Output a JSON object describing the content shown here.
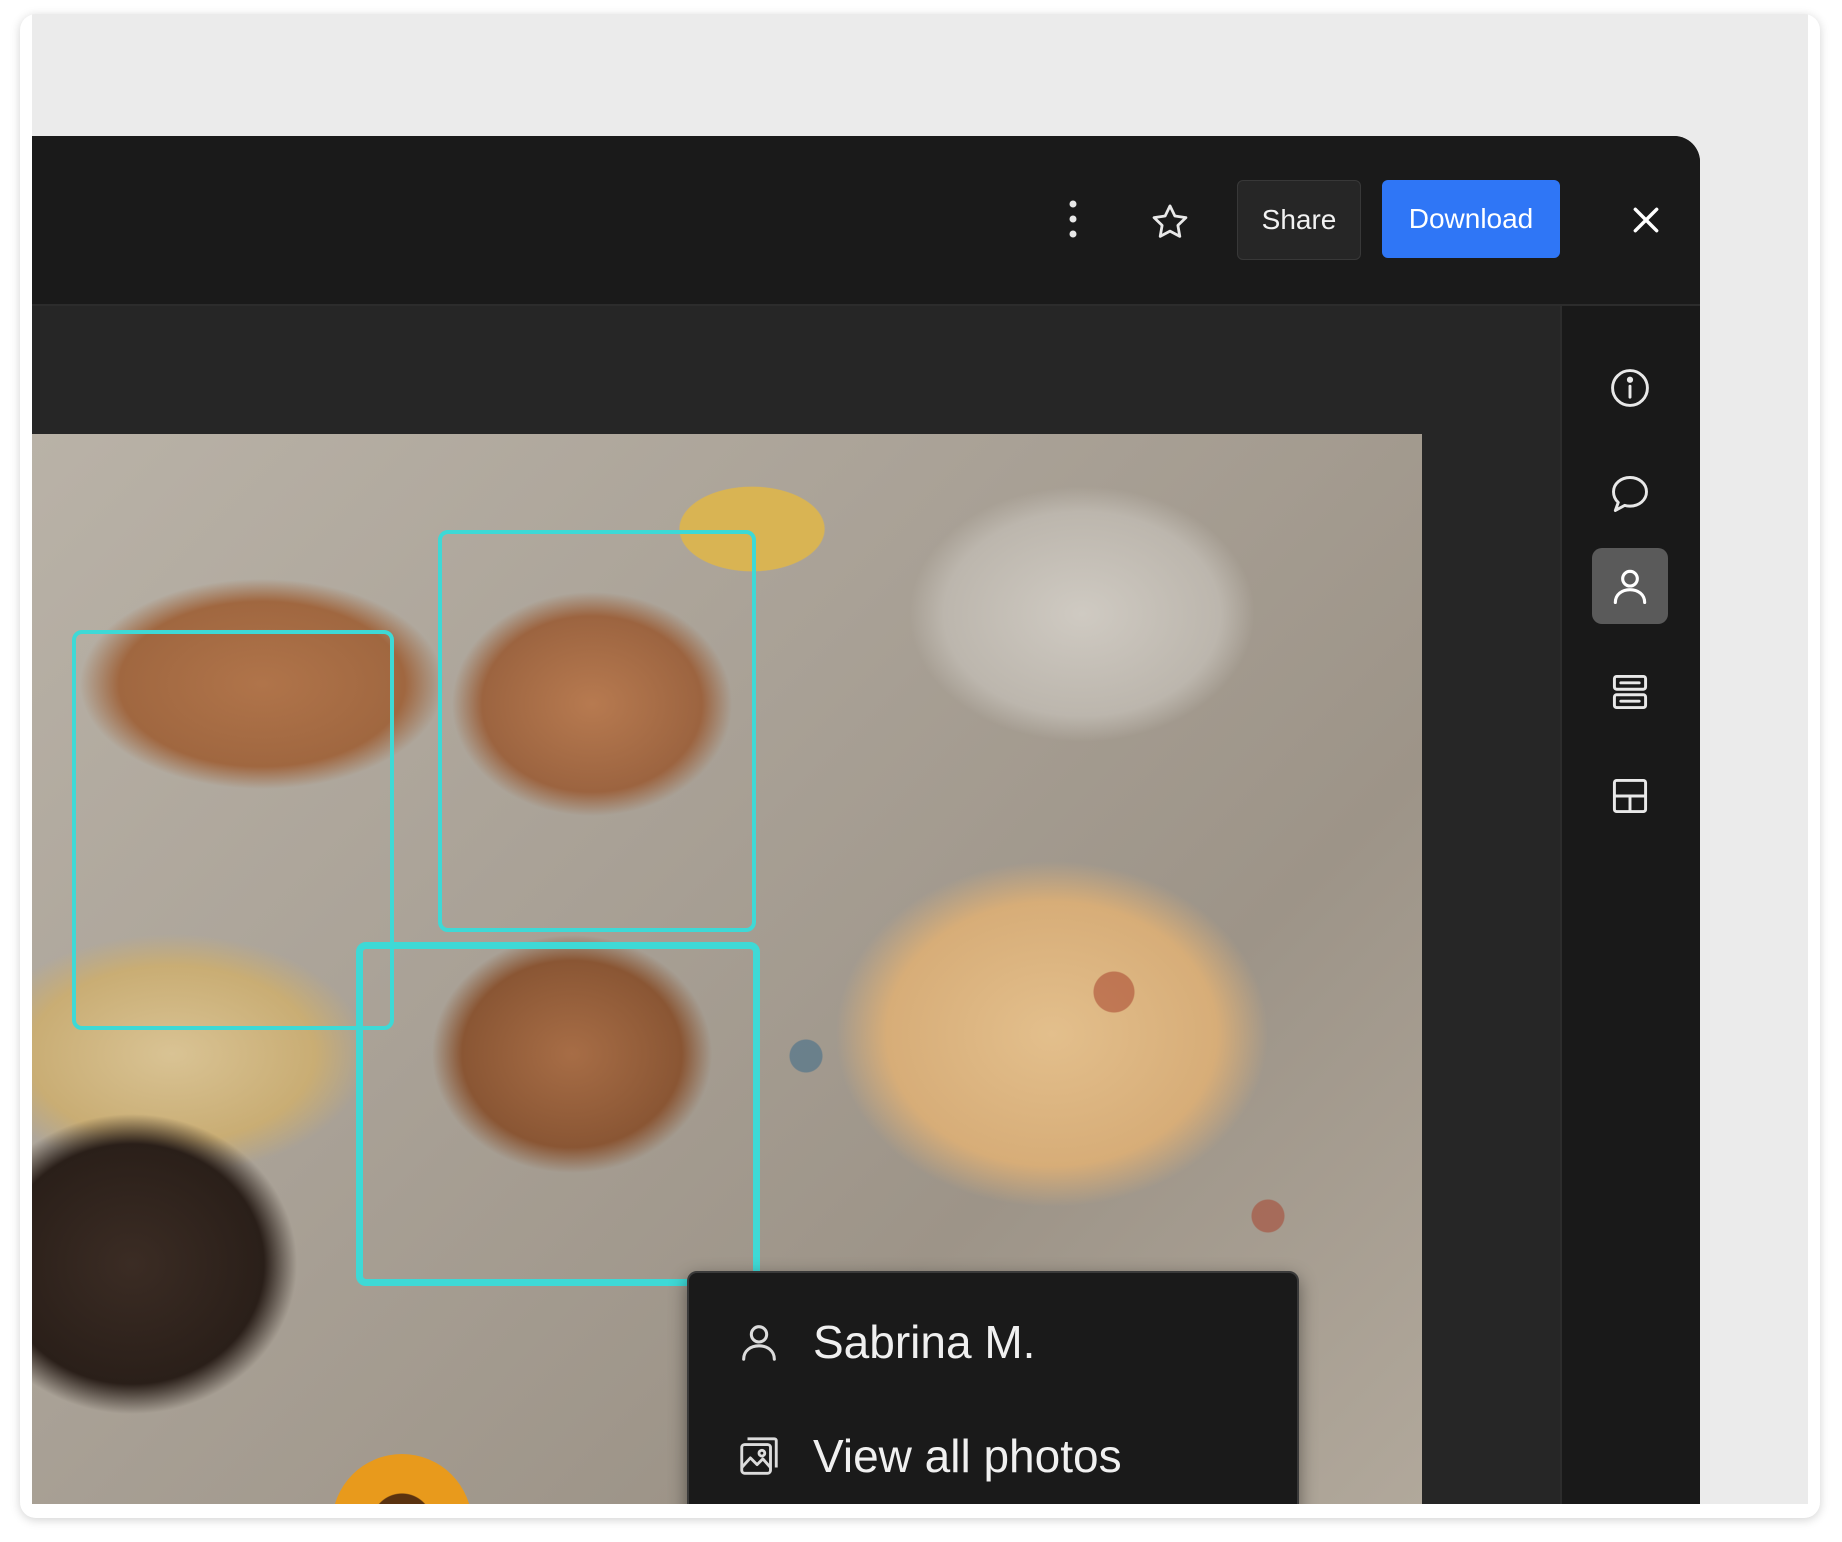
{
  "toolbar": {
    "more_icon": "more-vertical-icon",
    "favorite_icon": "star-icon",
    "share_label": "Share",
    "download_label": "Download",
    "close_icon": "close-icon"
  },
  "sidebar": {
    "items": [
      {
        "icon": "info-icon",
        "active": false
      },
      {
        "icon": "comment-icon",
        "active": false
      },
      {
        "icon": "person-icon",
        "active": true
      },
      {
        "icon": "list-cards-icon",
        "active": false
      },
      {
        "icon": "layout-icon",
        "active": false
      }
    ]
  },
  "photo": {
    "face_tags": 3,
    "accent_color": "#3ed9d6"
  },
  "popup": {
    "person_name": "Sabrina M.",
    "view_all_label": "View all photos"
  },
  "colors": {
    "primary": "#2f76f6",
    "face_box": "#3ed9d6",
    "panel": "#1a1a1a"
  }
}
